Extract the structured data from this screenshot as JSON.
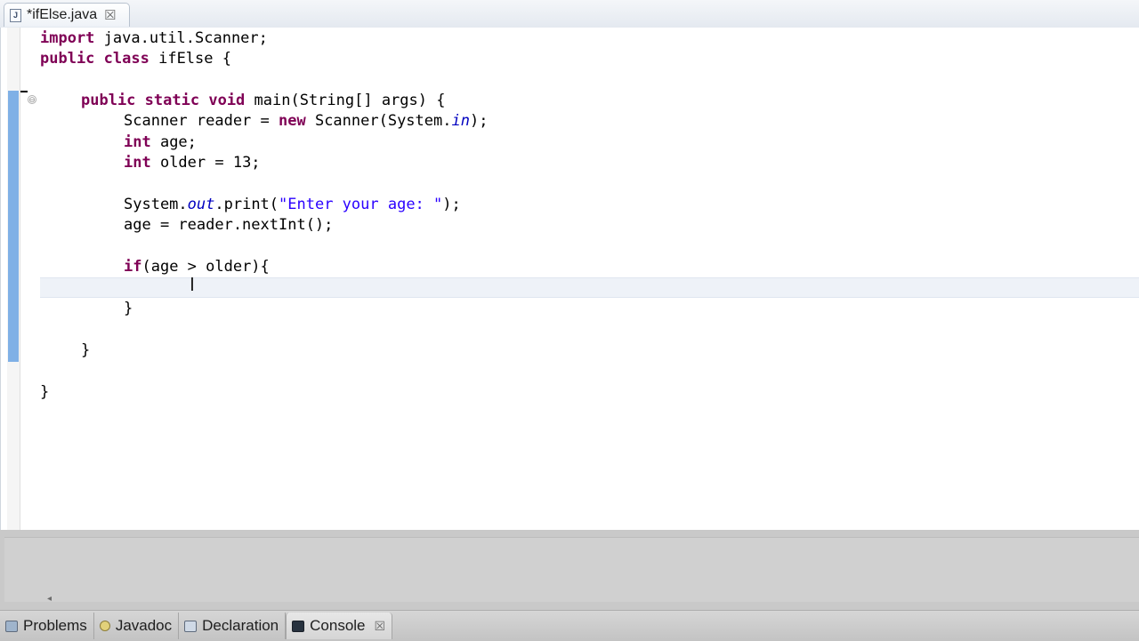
{
  "editor_tab": {
    "icon": "java-file-icon",
    "icon_glyph": "J",
    "title": "*ifElse.java",
    "close_glyph": "☒"
  },
  "code": {
    "l1": [
      "import",
      " java.util.Scanner;"
    ],
    "l2": [
      "public",
      " ",
      "class",
      " ifElse {"
    ],
    "l4": [
      "public",
      " ",
      "static",
      " ",
      "void",
      " main(String[] args) {"
    ],
    "l5": [
      "Scanner reader = ",
      "new",
      " Scanner(System.",
      "in",
      ");"
    ],
    "l6": [
      "int",
      " age;"
    ],
    "l7": [
      "int",
      " older = 13;"
    ],
    "l9": [
      "System.",
      "out",
      ".print(",
      "\"Enter your age: \"",
      ");"
    ],
    "l10": "age = reader.nextInt();",
    "l12": [
      "if",
      "(age > older){"
    ],
    "l14": "}",
    "l16": "}",
    "l18": "}"
  },
  "fold_glyph": "⊖",
  "cursor_glyph": "I",
  "scroll_arrow_glyph": "◂",
  "bottom_tabs": [
    {
      "label": "Problems",
      "icon": "problems-icon"
    },
    {
      "label": "Javadoc",
      "icon": "javadoc-icon"
    },
    {
      "label": "Declaration",
      "icon": "declaration-icon"
    },
    {
      "label": "Console",
      "icon": "console-icon",
      "active": true,
      "close_glyph": "☒"
    }
  ],
  "colors": {
    "keyword": "#7f0055",
    "string": "#2a00ff",
    "static_field": "#0000c0",
    "change_bar": "#7fb0e6"
  }
}
